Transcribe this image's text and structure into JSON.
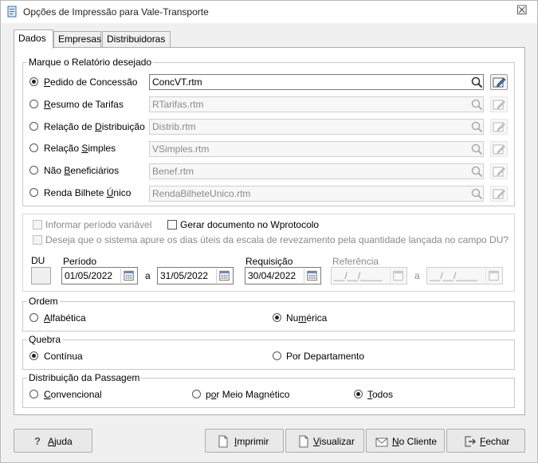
{
  "window": {
    "title": "Opções de Impressão para Vale-Transporte",
    "close_glyph": "☒"
  },
  "tabs": [
    "Dados",
    "Empresas",
    "Distribuidoras"
  ],
  "report_group": {
    "legend": "Marque o Relatório desejado",
    "items": [
      {
        "label_pre": "",
        "label_u": "P",
        "label_post": "edido de Concessão",
        "file": "ConcVT.rtm",
        "selected": true,
        "enabled": true
      },
      {
        "label_pre": "",
        "label_u": "R",
        "label_post": "esumo de Tarifas",
        "file": "RTarifas.rtm",
        "selected": false,
        "enabled": false
      },
      {
        "label_pre": "Relação de ",
        "label_u": "D",
        "label_post": "istribuição",
        "file": "Distrib.rtm",
        "selected": false,
        "enabled": false
      },
      {
        "label_pre": "Relação ",
        "label_u": "S",
        "label_post": "imples",
        "file": "VSimples.rtm",
        "selected": false,
        "enabled": false
      },
      {
        "label_pre": "Não ",
        "label_u": "B",
        "label_post": "eneficiários",
        "file": "Benef.rtm",
        "selected": false,
        "enabled": false
      },
      {
        "label_pre": "Renda Bilhete ",
        "label_u": "Ú",
        "label_post": "nico",
        "file": "RendaBilheteUnico.rtm",
        "selected": false,
        "enabled": false
      }
    ]
  },
  "options": {
    "informar_periodo": "Informar período variável",
    "gerar_documento": "Gerar documento no Wprotocolo",
    "apurar_dias": "Deseja que o sistema apure os dias úteis da escala de revezamento pela quantidade lançada no campo DU?"
  },
  "dates": {
    "du_label": "DU",
    "periodo_label": "Período",
    "periodo_start": "01/05/2022",
    "sep": "a",
    "periodo_end": "31/05/2022",
    "requisicao_label": "Requisição",
    "requisicao": "30/04/2022",
    "referencia_label": "Referência",
    "referencia_start": "__/__/____",
    "referencia_end": "__/__/____"
  },
  "ordem": {
    "legend": "Ordem",
    "alfabetica_u": "A",
    "alfabetica_post": "lfabética",
    "numerica_pre": "Nu",
    "numerica_u": "m",
    "numerica_post": "érica",
    "selected": "numerica"
  },
  "quebra": {
    "legend": "Quebra",
    "continua": "Contínua",
    "departamento": "Por Departamento",
    "selected": "continua"
  },
  "distribuicao": {
    "legend": "Distribuição da Passagem",
    "convencional_u": "C",
    "convencional_post": "onvencional",
    "magnetico_pre": "p",
    "magnetico_u": "o",
    "magnetico_post": "r Meio Magnético",
    "todos_u": "T",
    "todos_post": "odos",
    "selected": "todos"
  },
  "buttons": {
    "ajuda_u": "A",
    "ajuda_post": "juda",
    "imprimir_u": "I",
    "imprimir_post": "mprimir",
    "visualizar_u": "V",
    "visualizar_post": "isualizar",
    "cliente_u": "N",
    "cliente_post": "o Cliente",
    "fechar_u": "F",
    "fechar_post": "echar"
  },
  "colors": {
    "accent": "#2b6cb0",
    "panel": "#ffffff",
    "window_bg": "#f0f0f0"
  }
}
